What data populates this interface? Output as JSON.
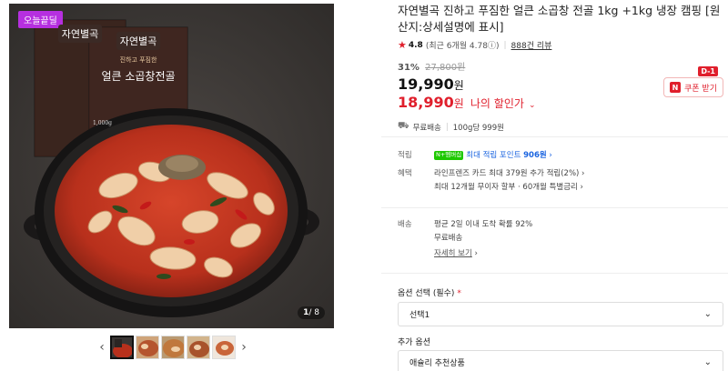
{
  "gallery": {
    "badge": "오늘끝딜",
    "counter_current": "1",
    "counter_total": "/ 8",
    "prev_arrow": "‹",
    "next_arrow": "›",
    "package_brand": "자연별곡",
    "package_subtitle": "진하고 푸짐한",
    "package_product": "얼큰 소곱창전골",
    "package_weight": "1,000g"
  },
  "product": {
    "title": "자연별곡 진하고 푸짐한 얼큰 소곱창 전골 1kg +1kg 냉장 캠핑 [원산지:상세설명에 표시]",
    "rating_score": "4.8",
    "rating_recent": "(최근 6개월 4.78",
    "rating_info": "ⓘ)",
    "review_link": "888건 리뷰",
    "discount_rate": "31%",
    "original_price": "27,800원",
    "sale_price": "19,990",
    "won": "원",
    "my_price": "18,990",
    "my_price_label": "나의 할인가",
    "my_price_chevron": "⌄",
    "dday": "D-1",
    "coupon_icon": "N",
    "coupon_label": "쿠폰 받기",
    "free_shipping": "무료배송",
    "unit_price": "100g당 999원"
  },
  "details": {
    "points_key": "적립",
    "points_tag": "N+멤버십",
    "points_text_prefix": "최대 적립 포인트",
    "points_value": "906원",
    "points_chevron": "›",
    "benefit_key": "혜택",
    "benefit_line1": "라인프렌즈 카드 최대 379원 추가 적립(2%) ›",
    "benefit_line2": "최대 12개월 무이자 할부 · 60개월 특별금리 ›",
    "delivery_key": "배송",
    "delivery_line1": "평균 2일 이내 도착 확률 92%",
    "delivery_line2": "무료배송",
    "delivery_more": "자세히 보기",
    "delivery_more_chev": "›"
  },
  "options": {
    "required_label": "옵션 선택 (필수)",
    "required_mark": "*",
    "required_value": "선택1",
    "extra_label": "추가 옵션",
    "extra_value": "애슐리 추천상품",
    "chevron": "⌄"
  },
  "colors": {
    "accent_red": "#e01f2c",
    "points_green": "#1ec800",
    "points_blue": "#1a64e0",
    "badge_purple": "#b62fe0"
  }
}
